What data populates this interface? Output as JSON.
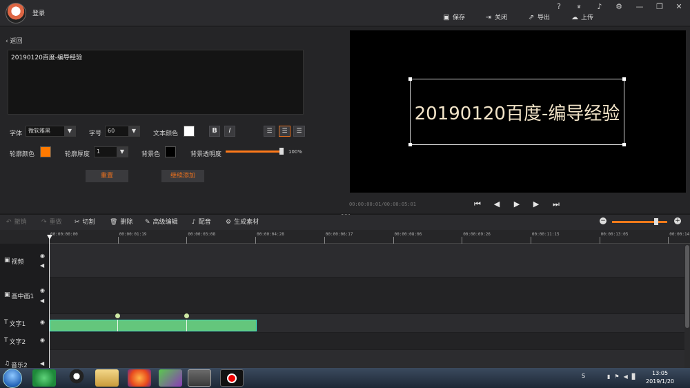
{
  "header": {
    "login": "登录",
    "window_controls": [
      "?",
      "VIP",
      "bell",
      "gear",
      "minimize",
      "restore",
      "close"
    ],
    "actions": [
      {
        "label": "保存",
        "icon": "save-icon"
      },
      {
        "label": "关闭",
        "icon": "close-doc-icon"
      },
      {
        "label": "导出",
        "icon": "export-icon"
      },
      {
        "label": "上传",
        "icon": "upload-icon"
      }
    ]
  },
  "left": {
    "back_label": "返回",
    "text_value": "20190120百度-编导经验",
    "font_label": "字体",
    "font_value": "微软雅黑",
    "size_label": "字号",
    "size_value": "60",
    "color_label": "文本颜色",
    "text_color": "#ffffff",
    "bold": "B",
    "italic": "I",
    "outline_color_label": "轮廓颜色",
    "outline_color": "#ff7a00",
    "outline_width_label": "轮廓厚度",
    "outline_width_value": "1",
    "bg_color_label": "背景色",
    "bg_color": "#000000",
    "bg_opacity_label": "背景透明度",
    "bg_opacity_value": "100%",
    "bg_opacity_fraction": 1.0,
    "reset_label": "重置",
    "continue_label": "继续添加"
  },
  "preview": {
    "text": "20190120百度-编导经验",
    "timecode": "00:00:00:01/00:00:05:01"
  },
  "toolbar": {
    "undo": "撤销",
    "redo": "重做",
    "cut": "切割",
    "delete": "删除",
    "advanced": "高级编辑",
    "dub": "配音",
    "generate": "生成素材"
  },
  "timeline": {
    "ticks": [
      "00:00:00:00",
      "00:00:01:19",
      "00:00:03:08",
      "00:00:04:28",
      "00:00:06:17",
      "00:00:08:06",
      "00:00:09:26",
      "00:00:11:15",
      "00:00:13:05",
      "00:00:14:"
    ],
    "tracks": [
      "视频",
      "画中画1",
      "文字1",
      "文字2",
      "音乐2"
    ]
  },
  "taskbar": {
    "time": "13:05",
    "date": "2019/1/20"
  },
  "colors": {
    "accent": "#e8701e",
    "clip": "#64c67c"
  }
}
